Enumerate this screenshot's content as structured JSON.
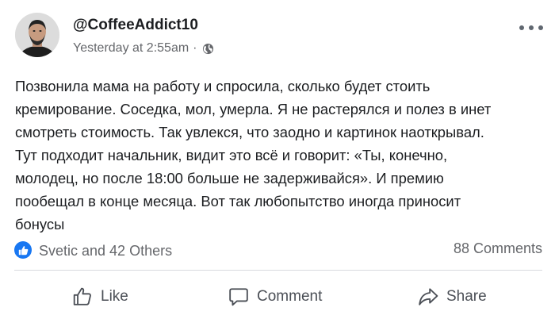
{
  "post": {
    "author": {
      "username": "@CoffeeAddict10",
      "avatar_icon": "profile-photo"
    },
    "timestamp": "Yesterday at 2:55am",
    "separator": "·",
    "visibility_icon": "globe-icon",
    "menu_icon": "more-options-icon",
    "body_lines": [
      "Позвонила мама на работу и спросила, сколько будет стоить",
      "кремирование. Соседка, мол, умерла. Я не растерялся и полез в инет",
      "смотреть стоимость. Так увлекся, что заодно и картинок наоткрывал.",
      "Тут подходит начальник, видит это всё и говорит: «Ты, конечно,",
      "молодец, но после 18:00 больше не задерживайся». И премию",
      "пообещал в конце месяца. Вот так любопытство иногда приносит",
      "бонусы"
    ]
  },
  "stats": {
    "reaction_icon": "like-reaction-icon",
    "reactions_text": "Svetic and 42 Others",
    "comments_text": "88 Comments"
  },
  "actions": {
    "like_label": "Like",
    "comment_label": "Comment",
    "share_label": "Share"
  },
  "colors": {
    "accent": "#1877f2",
    "secondary_text": "#65676b",
    "action_text": "#4b4f56",
    "divider": "#d8dadf"
  }
}
